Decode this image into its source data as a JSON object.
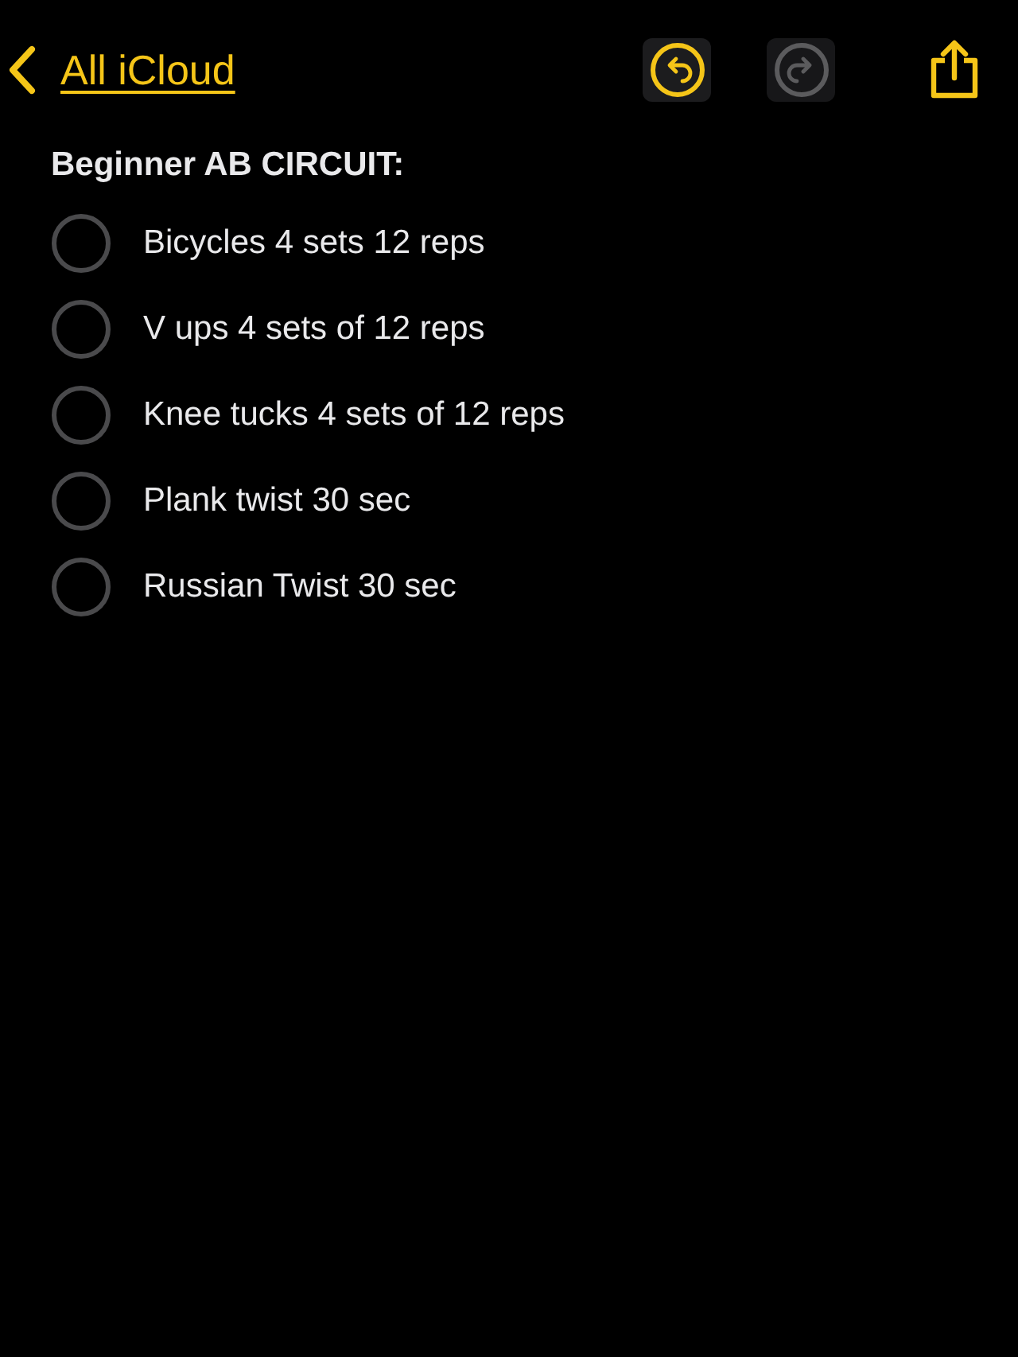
{
  "nav": {
    "back_label": "All iCloud",
    "undo": {
      "disabled": false
    },
    "redo": {
      "disabled": true
    }
  },
  "note": {
    "title": "Beginner AB CIRCUIT:",
    "checklist": [
      {
        "text": "Bicycles 4 sets 12 reps",
        "checked": false
      },
      {
        "text": "V ups 4 sets of 12 reps",
        "checked": false
      },
      {
        "text": "Knee tucks 4 sets of 12 reps",
        "checked": false
      },
      {
        "text": "Plank twist 30 sec",
        "checked": false
      },
      {
        "text": "Russian Twist 30 sec",
        "checked": false
      }
    ]
  }
}
